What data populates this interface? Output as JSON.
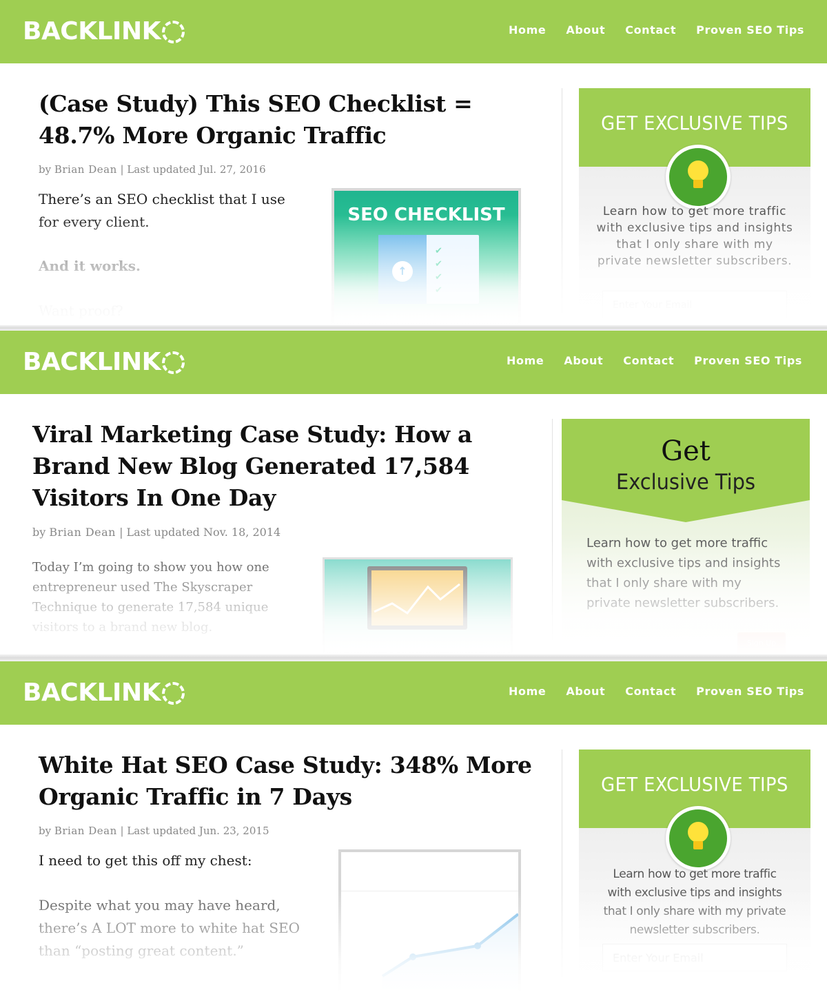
{
  "brand": {
    "logo_text": "BACKLINK"
  },
  "nav": {
    "home": "Home",
    "about": "About",
    "contact": "Contact",
    "tips": "Proven SEO Tips"
  },
  "posts": [
    {
      "title": "(Case Study) This SEO Checklist = 48.7% More Organic Traffic",
      "by": "by",
      "author": "Brian Dean",
      "updated": "| Last updated Jul. 27, 2016",
      "p1": "There’s an SEO checklist that I use for every client.",
      "p2": "And it works.",
      "p3": "Want proof?",
      "image_caption": "SEO CHECKLIST"
    },
    {
      "title": "Viral Marketing Case Study: How a Brand New Blog Generated 17,584 Visitors In One Day",
      "by": "by",
      "author": "Brian Dean",
      "updated": "| Last updated Nov. 18, 2014",
      "p1": "Today I’m going to show you how one entrepreneur used The Skyscraper Technique to generate 17,584 unique visitors to a brand new blog."
    },
    {
      "title": "White Hat SEO Case Study: 348% More Organic Traffic in 7 Days",
      "by": "by",
      "author": "Brian Dean",
      "updated": "| Last updated Jun. 23, 2015",
      "p1": "I need to get this off my chest:",
      "p2": "Despite what you may have heard, there’s A LOT more to white hat SEO than “posting great content.”"
    }
  ],
  "widgets": [
    {
      "title": "GET EXCLUSIVE TIPS",
      "text": "Learn how to get more traffic with exclusive tips and insights that I only share with my private newsletter subscribers.",
      "email_placeholder": "Enter Your Email"
    },
    {
      "title_line1": "Get",
      "title_line2": "Exclusive Tips",
      "text": "Learn how to get more traffic with exclusive tips and insights that I only share with my private newsletter subscribers.",
      "button": "Sign Up"
    },
    {
      "title": "GET EXCLUSIVE TIPS",
      "text": "Learn how to get more traffic with exclusive tips and insights that I only share with my private newsletter subscribers.",
      "email_placeholder": "Enter Your Email"
    }
  ],
  "colors": {
    "brand_green": "#9fce52",
    "bulb_green": "#4aa52f",
    "checklist_teal": "#1fb58f"
  },
  "icons": [
    "lightbulb-icon",
    "upload-arrow-icon",
    "checkmark-icon"
  ]
}
